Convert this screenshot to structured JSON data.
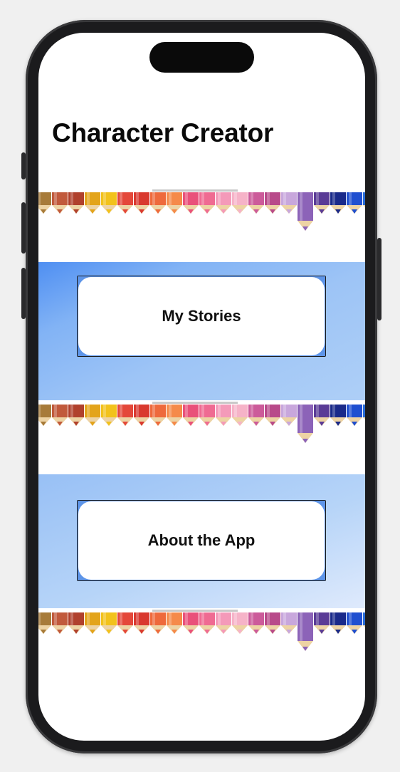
{
  "screen": {
    "title": "Character Creator"
  },
  "buttons": {
    "my_stories": "My Stories",
    "about_app": "About the App"
  },
  "banner": {
    "decor": "colored-pencils-row"
  },
  "colors": {
    "accent_blue": "#5e95e8",
    "button_border": "#1a1a1a",
    "title_color": "#0a0a0a"
  }
}
